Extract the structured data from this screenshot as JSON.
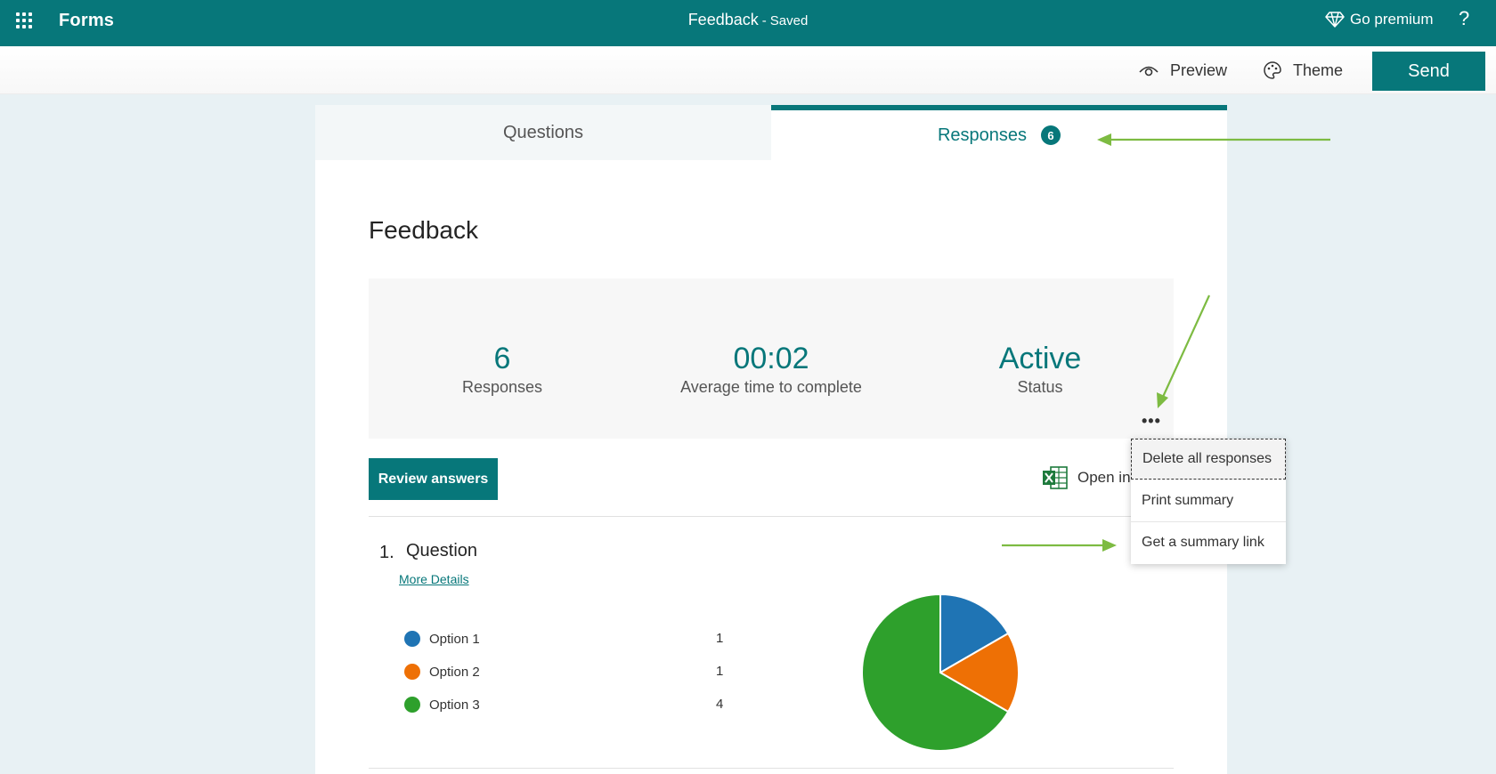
{
  "topbar": {
    "app_name": "Forms",
    "doc_title": "Feedback",
    "separator": "-",
    "save_status": "Saved",
    "premium_label": "Go premium",
    "help_label": "?",
    "bg_color": "#07777a"
  },
  "toolbar": {
    "preview_label": "Preview",
    "theme_label": "Theme",
    "send_label": "Send"
  },
  "tabs": {
    "questions": "Questions",
    "responses": "Responses",
    "responses_count": "6"
  },
  "form": {
    "title": "Feedback"
  },
  "stats": {
    "responses_value": "6",
    "responses_label": "Responses",
    "avg_time_value": "00:02",
    "avg_time_label": "Average time to complete",
    "status_value": "Active",
    "status_label": "Status",
    "more_label": "•••"
  },
  "actions": {
    "review_label": "Review answers",
    "open_excel_label": "Open in"
  },
  "menu": {
    "items": [
      {
        "label": "Delete all responses"
      },
      {
        "label": "Print summary"
      },
      {
        "label": "Get a summary link"
      }
    ]
  },
  "question": {
    "number": "1.",
    "title": "Question",
    "more_details": "More Details",
    "options": [
      {
        "label": "Option 1",
        "count": "1",
        "color": "#1f74b4"
      },
      {
        "label": "Option 2",
        "count": "1",
        "color": "#ee7005"
      },
      {
        "label": "Option 3",
        "count": "4",
        "color": "#2ea02c"
      }
    ]
  },
  "chart_data": {
    "type": "pie",
    "categories": [
      "Option 1",
      "Option 2",
      "Option 3"
    ],
    "values": [
      1,
      1,
      4
    ],
    "colors": [
      "#1f74b4",
      "#ee7005",
      "#2ea02c"
    ]
  },
  "annotation_color": "#7dbb42"
}
